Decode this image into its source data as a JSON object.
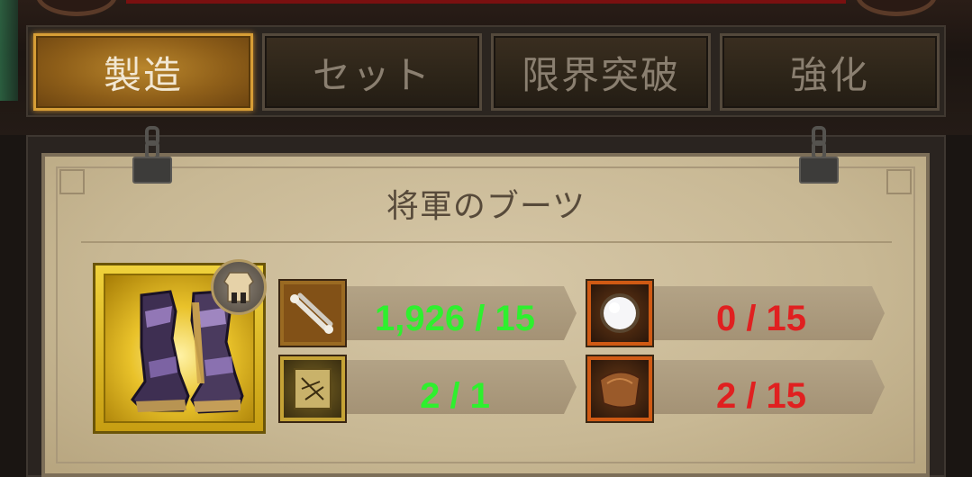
{
  "tabs": [
    {
      "label": "製造",
      "active": true
    },
    {
      "label": "セット",
      "active": false
    },
    {
      "label": "限界突破",
      "active": false
    },
    {
      "label": "強化",
      "active": false
    }
  ],
  "item": {
    "name": "将軍のブーツ",
    "icon": "boots-icon",
    "badge_icon": "armor-slot-icon"
  },
  "materials": [
    {
      "icon": "bones-icon",
      "value": "1,926 / 15",
      "color": "#2ef02e"
    },
    {
      "icon": "pearl-icon",
      "value": "0 / 15",
      "color": "#e02020"
    },
    {
      "icon": "recipe-scroll-icon",
      "value": "2 / 1",
      "color": "#2ef02e"
    },
    {
      "icon": "leather-icon",
      "value": "2 / 15",
      "color": "#e02020"
    }
  ],
  "colors": {
    "active_tab": "#b9862c",
    "sufficient": "#2ef02e",
    "insufficient": "#e02020"
  }
}
